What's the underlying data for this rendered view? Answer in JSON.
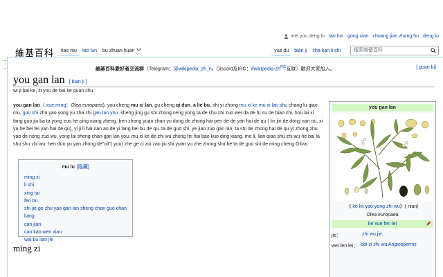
{
  "personal": {
    "user": "mei you deng lu",
    "talk": "tao lun",
    "contrib": "gong xian",
    "create": "chuang jian zhang hu",
    "login": "deng lu"
  },
  "logo": "維基百科",
  "tabs_left": [
    {
      "label": "tiao mu",
      "state": "sel"
    },
    {
      "label": "tao lun",
      "state": "link"
    },
    {
      "label": "bu zhuan huan",
      "state": "dropdown"
    }
  ],
  "tabs_right": [
    {
      "label": "yue du",
      "state": "sel"
    },
    {
      "label": "bian ji",
      "state": "link"
    },
    {
      "label": "cha kan li shi",
      "state": "link"
    }
  ],
  "search": {
    "placeholder": "搜索维基百科"
  },
  "notice": {
    "bold": "維基百科愛好者交流群",
    "part1": "（Telegram：",
    "tg": "@wikipedia_zh_n",
    "part2": "、Discord",
    "discord": "",
    "part3": "及IRC：",
    "irc": "#wikipedia-zh",
    "sup": "IRC",
    "part4": "互联）歡迎大家加入。"
  },
  "convert_label": "[ guan bi]",
  "title": "you gan lan",
  "edit_link": "[ bian ji ]",
  "tagline": "wi ji bai ke, zi you de bai ke quan shu",
  "body_text": "you gan lan（ xue ming：Olea europaea), you cheng mu xi lan, gu cheng qi dun, a lie bu, shi yi zhong mu xi ke mu xi lan shu chang lu qiao mu, guo shi zhu yao yong yu zha zhi gan lan you. sheng jing gu shi zhong ceng yong ta de shu zhi zuo wei da de fu su de biao zhi, hou lai xi fang guo jia ba ta yong zuo he ping xiang zheng. ben zhong yuan chan yu dong de zhong hai pen de de yan hai de qu ( lin jin de dong nan ou, xi ya he bei fei yan hai de qu), yi ji li hai nan an de yi lang bei bu de qu. ta de guo shi, ye jiao zuo gan lan, ta shi de zhong hai de qu yi zhong zhu yao de nong zuo wu, yong lai sheng chan gan lan you. mu xi ke de zhi wu zhong fei hai bao kuo ding xiang, mo li, lian qiao shu zhi wu he bai la shu shu zhi wu. hen duo yu yan zhong de\"oil\"( you) zhe ge ci zui zao jiu shi yuan yu zhe zhong shu he ta de guo shi de ming cheng Oliva.",
  "toc": {
    "title": "mu lu",
    "hide": "[隐藏]",
    "items": [
      "ming zi",
      "li shi",
      "xing tai",
      "fen bu",
      "shi jie ge zhu yao gan lan sheng chan guo chan liang",
      "can jian",
      "can kao wen xian",
      "wai bu lian jie"
    ]
  },
  "infobox": {
    "title": "you gan lan",
    "caption_link": "ke lei yao yong zhi wu",
    "caption_pre": "《 ",
    "caption_post": "》( nian)",
    "caption2": "Olea europaea",
    "section": "ke xue fen lei",
    "rows": [
      {
        "key": "jie：",
        "value": "zhi wu jie"
      },
      {
        "key": "wei fen lei：",
        "value": "bei zi zhi wu Angiosperms"
      }
    ]
  },
  "section_heading": "ming zi",
  "colors": {
    "link": "#0645ad",
    "infobox_header": "#d3f8c5",
    "border": "#a7d7f9"
  }
}
